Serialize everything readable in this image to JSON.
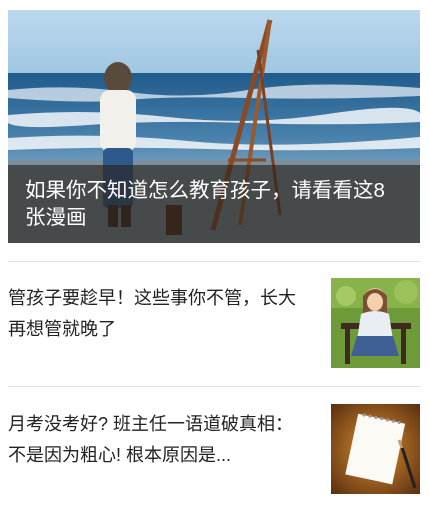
{
  "featured": {
    "title": "如果你不知道怎么教育孩子，请看看这8张漫画",
    "image": "child-by-the-sea-with-easel"
  },
  "articles": [
    {
      "title": "管孩子要趁早！这些事你不管，长大再想管就晚了",
      "thumbnail": "girl-sitting-on-bench-in-garden"
    },
    {
      "title": "月考没考好? 班主任一语道破真相：不是因为粗心! 根本原因是...",
      "thumbnail": "notepad-and-pen-on-wooden-desk"
    }
  ]
}
